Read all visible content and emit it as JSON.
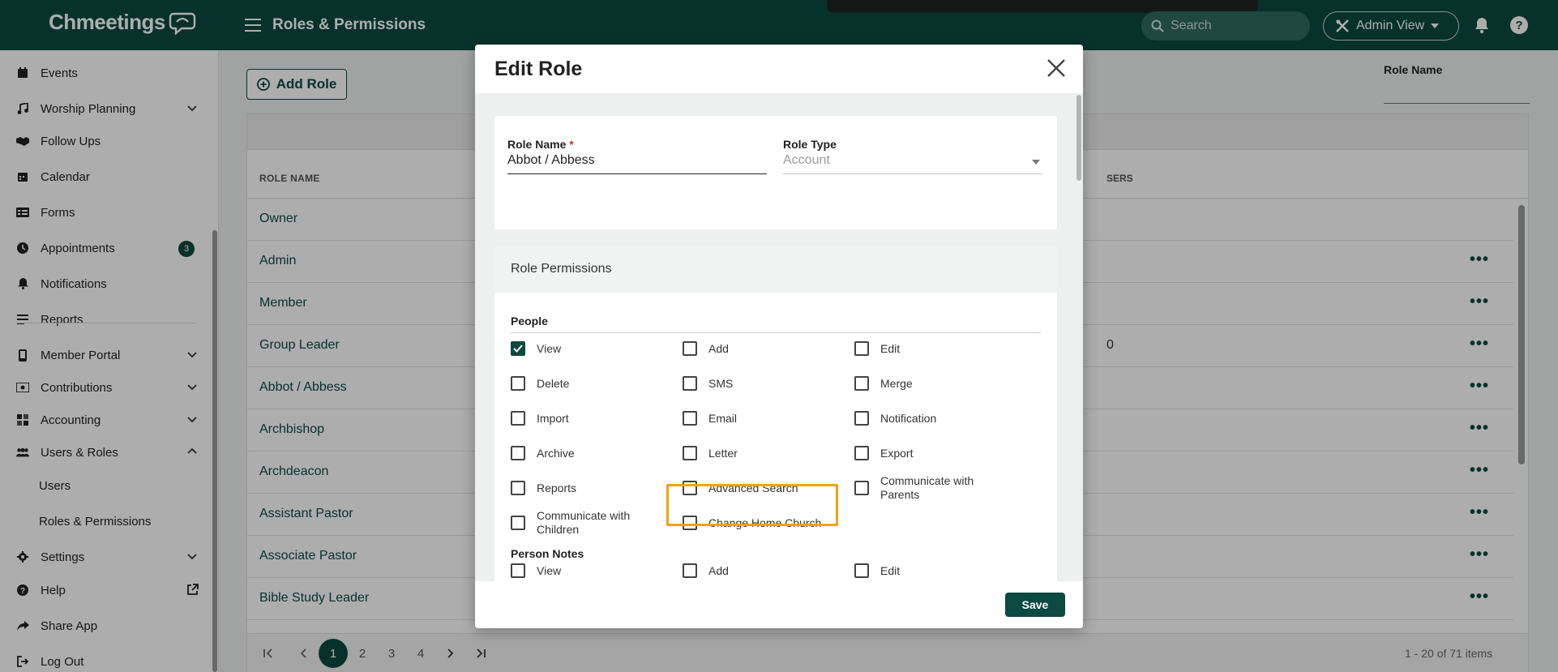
{
  "app": {
    "logo_text": "Chmeetings",
    "page_title": "Roles & Permissions",
    "search_placeholder": "Search",
    "admin_view_label": "Admin View"
  },
  "sidebar": {
    "items": [
      {
        "label": "Events",
        "icon": "calendar-event-icon"
      },
      {
        "label": "Worship Planning",
        "icon": "music-note-icon",
        "expandable": true
      },
      {
        "label": "Follow Ups",
        "icon": "handshake-icon"
      },
      {
        "label": "Calendar",
        "icon": "calendar-icon"
      },
      {
        "label": "Forms",
        "icon": "form-icon"
      },
      {
        "label": "Appointments",
        "icon": "clock-icon",
        "badge": "3"
      },
      {
        "label": "Notifications",
        "icon": "bell-icon"
      },
      {
        "label": "Reports",
        "icon": "reports-icon"
      },
      {
        "label": "Member Portal",
        "icon": "phone-icon",
        "expandable": true
      },
      {
        "label": "Contributions",
        "icon": "money-icon",
        "expandable": true
      },
      {
        "label": "Accounting",
        "icon": "grid-icon",
        "expandable": true
      },
      {
        "label": "Users & Roles",
        "icon": "users-icon",
        "expanded": true
      },
      {
        "label": "Users",
        "sub": true
      },
      {
        "label": "Roles & Permissions",
        "sub": true,
        "active": true
      },
      {
        "label": "Settings",
        "icon": "gear-icon",
        "expandable": true
      },
      {
        "label": "Help",
        "icon": "help-icon",
        "external": true
      },
      {
        "label": "Share App",
        "icon": "share-icon"
      },
      {
        "label": "Log Out",
        "icon": "logout-icon"
      }
    ]
  },
  "main": {
    "add_role_label": "Add Role",
    "filter_label": "Role Name",
    "columns": {
      "role_name": "ROLE NAME",
      "users": "SERS"
    },
    "rows": [
      {
        "name": "Owner",
        "users": ""
      },
      {
        "name": "Admin",
        "users": ""
      },
      {
        "name": "Member",
        "users": ""
      },
      {
        "name": "Group Leader",
        "users": "0"
      },
      {
        "name": "Abbot / Abbess",
        "users": ""
      },
      {
        "name": "Archbishop",
        "users": ""
      },
      {
        "name": "Archdeacon",
        "users": ""
      },
      {
        "name": "Assistant Pastor",
        "users": ""
      },
      {
        "name": "Associate Pastor",
        "users": ""
      },
      {
        "name": "Bible Study Leader",
        "users": ""
      }
    ],
    "row_menu": "•••",
    "pager": {
      "pages": [
        "1",
        "2",
        "3",
        "4"
      ],
      "current": "1",
      "info": "1 - 20 of 71 items"
    }
  },
  "modal": {
    "title": "Edit Role",
    "role_name_label": "Role Name",
    "required_mark": "*",
    "role_name_value": "Abbot / Abbess",
    "role_type_label": "Role Type",
    "role_type_value": "Account",
    "permissions_title": "Role Permissions",
    "sections": [
      {
        "title": "People",
        "permissions": [
          {
            "label": "View",
            "checked": true
          },
          {
            "label": "Add",
            "checked": false
          },
          {
            "label": "Edit",
            "checked": false
          },
          {
            "label": "Delete",
            "checked": false
          },
          {
            "label": "SMS",
            "checked": false
          },
          {
            "label": "Merge",
            "checked": false
          },
          {
            "label": "Import",
            "checked": false
          },
          {
            "label": "Email",
            "checked": false
          },
          {
            "label": "Notification",
            "checked": false
          },
          {
            "label": "Archive",
            "checked": false
          },
          {
            "label": "Letter",
            "checked": false
          },
          {
            "label": "Export",
            "checked": false
          },
          {
            "label": "Reports",
            "checked": false
          },
          {
            "label": "Advanced Search",
            "checked": false
          },
          {
            "label": "Communicate with Parents",
            "checked": false
          },
          {
            "label": "Communicate with Children",
            "checked": false
          },
          {
            "label": "Change Home Church",
            "checked": false,
            "highlighted": true
          }
        ]
      },
      {
        "title": "Person Notes",
        "permissions": [
          {
            "label": "View",
            "checked": false
          },
          {
            "label": "Add",
            "checked": false
          },
          {
            "label": "Edit",
            "checked": false
          }
        ]
      }
    ],
    "save_label": "Save"
  },
  "colors": {
    "brand": "#0b4a40",
    "highlight": "#f0a30a",
    "required": "#c0392b"
  }
}
